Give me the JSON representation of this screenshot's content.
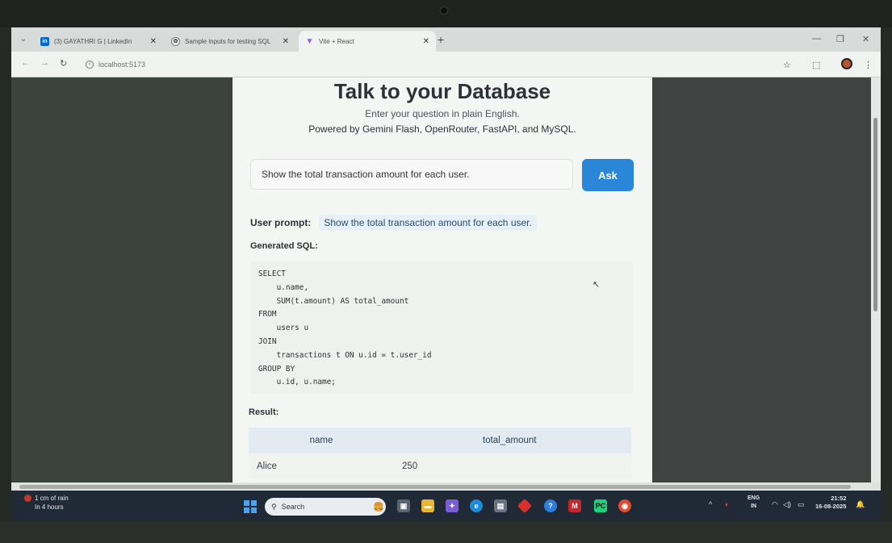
{
  "browser": {
    "tabs": [
      {
        "label": "(3) GAYATHRI G | LinkedIn",
        "icon": "linkedin-icon",
        "color": "#0a66c2",
        "active": false
      },
      {
        "label": "Sample inputs for testing SQL",
        "icon": "openai-icon",
        "color": "#444444",
        "active": false
      },
      {
        "label": "Vite + React",
        "icon": "vite-icon",
        "color": "#8a5cf6",
        "active": true
      }
    ],
    "url": "localhost:5173"
  },
  "app": {
    "title": "Talk to your Database",
    "subtitle": "Enter your question in plain English.",
    "powered_by": "Powered by Gemini Flash, OpenRouter, FastAPI, and MySQL.",
    "query_value": "Show the total transaction amount for each user.",
    "ask_label": "Ask",
    "user_prompt_label": "User prompt:",
    "user_prompt_text": "Show the total transaction amount for each user.",
    "sql_label": "Generated SQL:",
    "sql": "SELECT\n    u.name,\n    SUM(t.amount) AS total_amount\nFROM\n    users u\nJOIN\n    transactions t ON u.id = t.user_id\nGROUP BY\n    u.id, u.name;",
    "result_label": "Result:",
    "result": {
      "columns": [
        "name",
        "total_amount"
      ],
      "rows": [
        [
          "Alice",
          "250"
        ]
      ]
    },
    "accent_color": "#2a86d6"
  },
  "taskbar": {
    "weather_line1": "1 cm of rain",
    "weather_line2": "In 4 hours",
    "search_placeholder": "Search",
    "language_line1": "ENG",
    "language_line2": "IN",
    "time": "21:52",
    "date": "16-08-2025"
  }
}
